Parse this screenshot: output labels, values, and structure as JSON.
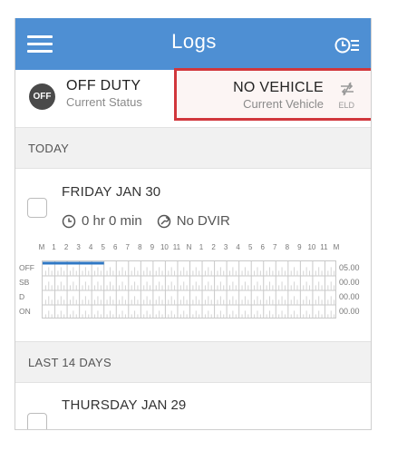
{
  "appbar": {
    "title": "Logs",
    "menu_icon": "hamburger-menu-icon",
    "right_icon": "clock-list-icon",
    "color": "#4e8fd3"
  },
  "status": {
    "badge": "OFF",
    "duty": "OFF DUTY",
    "duty_sub": "Current Status",
    "vehicle": "NO VEHICLE",
    "vehicle_sub": "Current Vehicle",
    "eld_icon": "disconnected-icon",
    "eld_label": "ELD",
    "highlight_color": "#d1373c"
  },
  "sections": {
    "today": "TODAY",
    "last14": "LAST 14 DAYS"
  },
  "today_log": {
    "day": "FRIDAY",
    "date": "JAN 30",
    "hours": "0 hr 0 min",
    "dvir": "No DVIR",
    "hour_labels": [
      "M",
      "1",
      "2",
      "3",
      "4",
      "5",
      "6",
      "7",
      "8",
      "9",
      "10",
      "11",
      "N",
      "1",
      "2",
      "3",
      "4",
      "5",
      "6",
      "7",
      "8",
      "9",
      "10",
      "11",
      "M"
    ],
    "rows": [
      {
        "label": "OFF",
        "total": "05.00"
      },
      {
        "label": "SB",
        "total": "00.00"
      },
      {
        "label": "D",
        "total": "00.00"
      },
      {
        "label": "ON",
        "total": "00.00"
      }
    ],
    "off_duty_hours": 5,
    "line_color": "#2f78c4"
  },
  "prev_log": {
    "day": "THURSDAY",
    "date": "JAN 29"
  }
}
